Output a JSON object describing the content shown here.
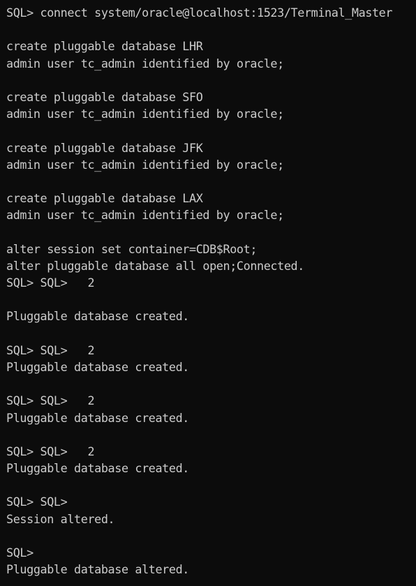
{
  "terminal": {
    "lines": [
      "SQL> connect system/oracle@localhost:1523/Terminal_Master",
      "",
      "create pluggable database LHR",
      "admin user tc_admin identified by oracle;",
      "",
      "create pluggable database SFO",
      "admin user tc_admin identified by oracle;",
      "",
      "create pluggable database JFK",
      "admin user tc_admin identified by oracle;",
      "",
      "create pluggable database LAX",
      "admin user tc_admin identified by oracle;",
      "",
      "alter session set container=CDB$Root;",
      "alter pluggable database all open;Connected.",
      "SQL> SQL>   2",
      "",
      "Pluggable database created.",
      "",
      "SQL> SQL>   2",
      "Pluggable database created.",
      "",
      "SQL> SQL>   2",
      "Pluggable database created.",
      "",
      "SQL> SQL>   2",
      "Pluggable database created.",
      "",
      "SQL> SQL>",
      "Session altered.",
      "",
      "SQL>",
      "Pluggable database altered."
    ]
  }
}
